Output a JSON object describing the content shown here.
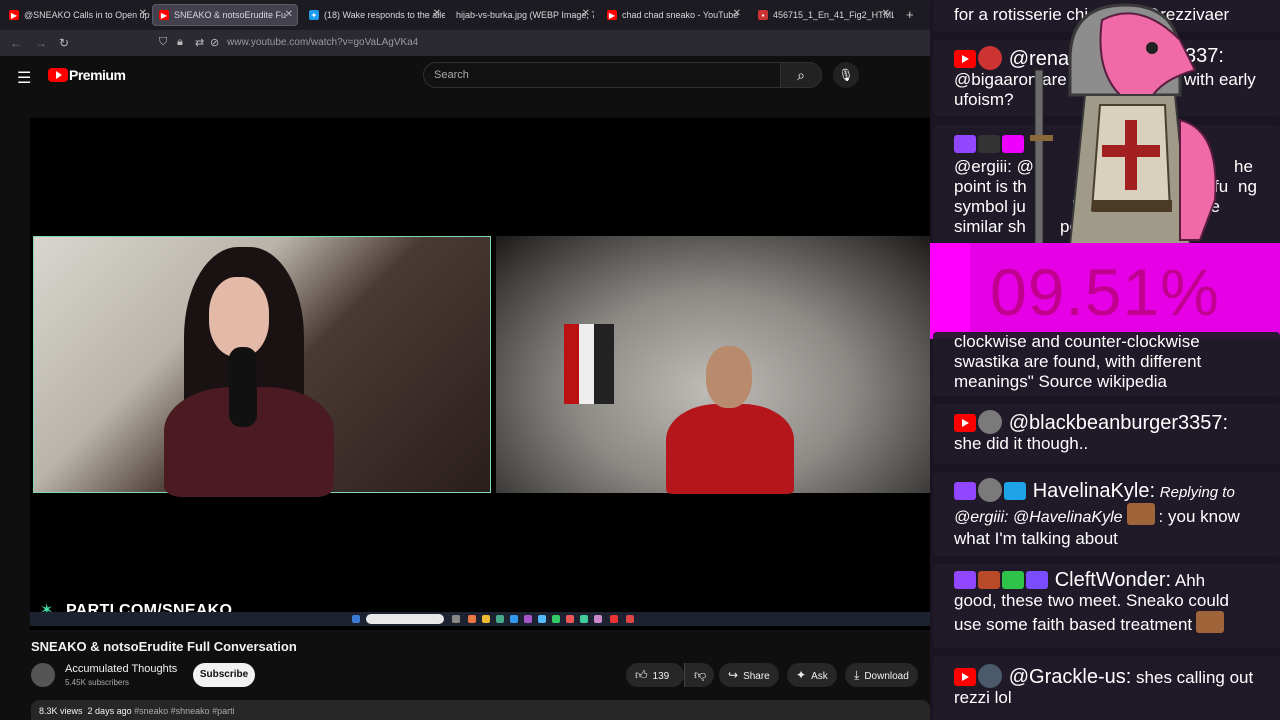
{
  "browser": {
    "tabs": [
      {
        "title": "@SNEAKO Calls in to Open up",
        "fav": "yt"
      },
      {
        "title": "SNEAKO & notsoErudite Fu",
        "fav": "yt",
        "active": true
      },
      {
        "title": "(18) Wake responds to the alleg",
        "fav": "tw"
      },
      {
        "title": "hijab-vs-burka.jpg (WEBP Image, 75",
        "fav": "img"
      },
      {
        "title": "chad chad sneako - YouTube",
        "fav": "yt"
      },
      {
        "title": "456715_1_En_41_Fig2_HTML.pn",
        "fav": "doc"
      }
    ],
    "new_tab": "+",
    "url": "www.youtube.com/watch?v=goVaLAgVKa4"
  },
  "youtube": {
    "logo": "Premium",
    "search_placeholder": "Search",
    "watermark": "PARTI.COM/SNEAKO",
    "video_title": "SNEAKO & notsoErudite Full Conversation",
    "channel": "Accumulated Thoughts",
    "subscribers": "5.45K subscribers",
    "subscribe": "Subscribe",
    "likes": "139",
    "share": "Share",
    "ask": "Ask",
    "download": "Download",
    "views": "8.3K views",
    "date": "2 days ago",
    "tags": "#sneako #shneako #parti"
  },
  "chat": {
    "top_fragment_a": "for a rotisserie chi",
    "top_fragment_b": "@rezzivaer",
    "m1_user": "@rena",
    "m1_user_tail": "337:",
    "m1_text_a": "@bigaaron are u",
    "m1_text_b": "with early",
    "m1_text_c": "ufoism?",
    "m2_text_a": "@ergiii: @",
    "m2_text_a2": "he",
    "m2_text_b": "point is th",
    "m2_text_b2": "fu",
    "m2_text_b3": "ng",
    "m2_text_c": "symbol ju",
    "m2_text_c2": "bec",
    "m2_text_c3": "ve",
    "m2_text_d": "similar sh",
    "m2_text_d2": "pe",
    "percent": "09.51%",
    "m3_text_a": "clockwise and counter-clockwise",
    "m3_text_b": "swastika are found, with different",
    "m3_text_c": "meanings\" Source wikipedia",
    "m4_user": "@blackbeanburger3357:",
    "m4_text": "she did it though..",
    "m5_user": "HavelinaKyle:",
    "m5_reply": "Replying to",
    "m5_reply_user": "@ergiii: @HavelinaKyle",
    "m5_text_a": ": you know",
    "m5_text_b": "what I'm talking about",
    "m6_user": "CleftWonder:",
    "m6_text_a": "Ahh",
    "m6_text_b": "good, these two meet. Sneako could",
    "m6_text_c": "use some faith based treatment",
    "m7_user": "@Grackle-us:",
    "m7_text_a": "shes calling out",
    "m7_text_b": "rezzi lol"
  }
}
